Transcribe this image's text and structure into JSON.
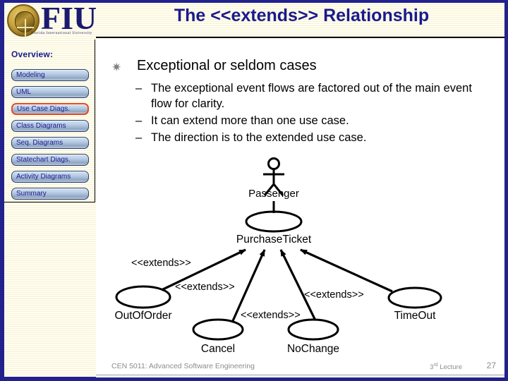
{
  "branding": {
    "logo_letters": "FIU",
    "logo_subtitle": "Florida International University",
    "accent_navy": "#23218c",
    "title_color": "#1a1a8c",
    "selected_outline": "#e8491f"
  },
  "header": {
    "title": "The <<extends>>  Relationship"
  },
  "sidebar": {
    "heading": "Overview:",
    "items": [
      {
        "label": "Modeling",
        "selected": false
      },
      {
        "label": "UML",
        "selected": false
      },
      {
        "label": "Use Case Diags.",
        "selected": true
      },
      {
        "label": "Class Diagrams",
        "selected": false
      },
      {
        "label": "Seq. Diagrams",
        "selected": false
      },
      {
        "label": "Statechart Diags.",
        "selected": false
      },
      {
        "label": "Activity Diagrams",
        "selected": false
      },
      {
        "label": "Summary",
        "selected": false
      }
    ]
  },
  "main": {
    "bullet_glyph": "✷",
    "bullet": "Exceptional or seldom cases",
    "dash_glyph": "–",
    "sub_bullets": [
      "The exceptional event flows are factored out of the main event flow for clarity.",
      "It can extend more than one use case.",
      "The direction is to the extended use case."
    ]
  },
  "diagram": {
    "actor": {
      "name": "Passenger"
    },
    "use_cases": [
      {
        "id": "purchase",
        "label": "PurchaseTicket"
      },
      {
        "id": "outoforder",
        "label": "OutOfOrder"
      },
      {
        "id": "cancel",
        "label": "Cancel"
      },
      {
        "id": "nochange",
        "label": "NoChange"
      },
      {
        "id": "timeout",
        "label": "TimeOut"
      }
    ],
    "stereotype_labels": [
      {
        "id": "ext1",
        "text": "<<extends>>"
      },
      {
        "id": "ext2",
        "text": "<<extends>>"
      },
      {
        "id": "ext3",
        "text": "<<extends>>"
      },
      {
        "id": "ext4",
        "text": "<<extends>>"
      }
    ]
  },
  "footer": {
    "course": "CEN 5011: Advanced Software Engineering",
    "lecture_number": "3",
    "lecture_suffix": "rd",
    "lecture_word": " Lecture",
    "page": "27"
  }
}
